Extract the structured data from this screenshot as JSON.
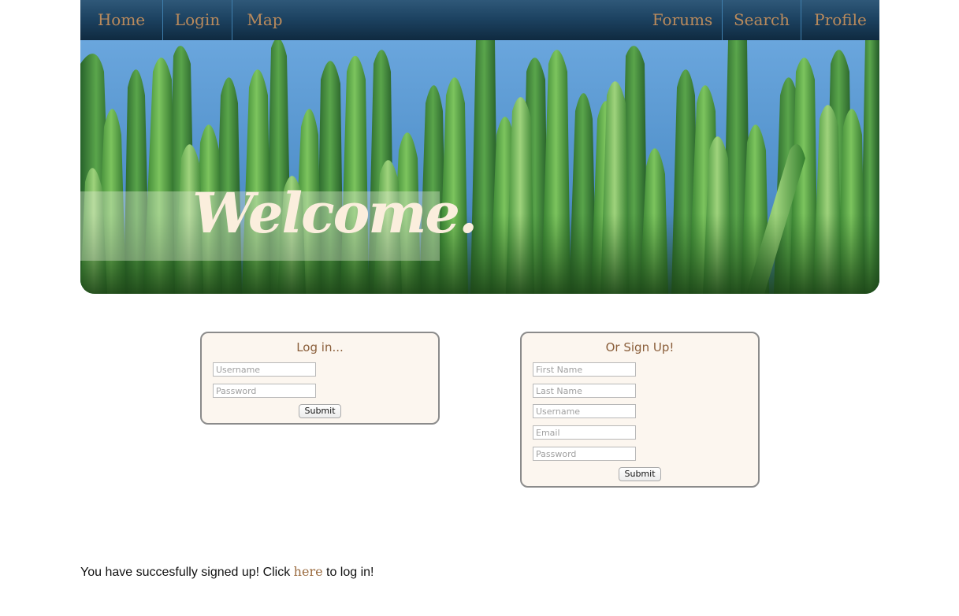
{
  "nav": {
    "left": [
      {
        "label": "Home"
      },
      {
        "label": "Login"
      },
      {
        "label": "Map"
      }
    ],
    "right": [
      {
        "label": "Forums"
      },
      {
        "label": "Search"
      },
      {
        "label": "Profile"
      }
    ],
    "text_color": "#b98a5c"
  },
  "hero": {
    "welcome_text": "Welcome.",
    "image": "grass-photo"
  },
  "login": {
    "title": "Log in...",
    "username_placeholder": "Username",
    "password_placeholder": "Password",
    "submit_label": "Submit"
  },
  "signup": {
    "title": "Or Sign Up!",
    "first_name_placeholder": "First Name",
    "last_name_placeholder": "Last Name",
    "username_placeholder": "Username",
    "email_placeholder": "Email",
    "password_placeholder": "Password",
    "submit_label": "Submit"
  },
  "message": {
    "before": "You have succesfully signed up! Click ",
    "link": "here",
    "after": " to log in!"
  },
  "colors": {
    "nav_bg": "#1d4362",
    "accent_brown": "#9a6b3f",
    "panel_bg": "#fcf6ef"
  }
}
